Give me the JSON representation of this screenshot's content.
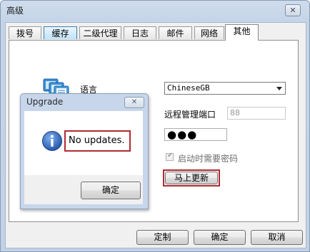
{
  "window": {
    "title": "高级",
    "close_icon": "close-icon",
    "close_glyph": "✕"
  },
  "tabs": [
    {
      "label": "拨号"
    },
    {
      "label": "缓存"
    },
    {
      "label": "二级代理"
    },
    {
      "label": "日志"
    },
    {
      "label": "邮件"
    },
    {
      "label": "网络"
    },
    {
      "label": "其他"
    }
  ],
  "active_tab": "其他",
  "other": {
    "language_icon": "language-icon",
    "language_label": "语言",
    "language_value": "ChineseGB",
    "remote_port_label": "远程管理端口",
    "remote_port_value": "88",
    "password_mask": "●●●",
    "require_password_label": "启动时需要密码",
    "require_password_checked": true,
    "update_button": "马上更新"
  },
  "footer": {
    "customize_button": "定制",
    "ok_button": "确定",
    "cancel_button": "取消"
  },
  "dialog": {
    "title": "Upgrade",
    "close_glyph": "✕",
    "icon": "info-icon",
    "message": "No updates.",
    "ok_button": "确定"
  },
  "colors": {
    "highlight": "#b02a31",
    "title_bar": "#c4d4e8",
    "info_icon": "#2c5fb3"
  }
}
